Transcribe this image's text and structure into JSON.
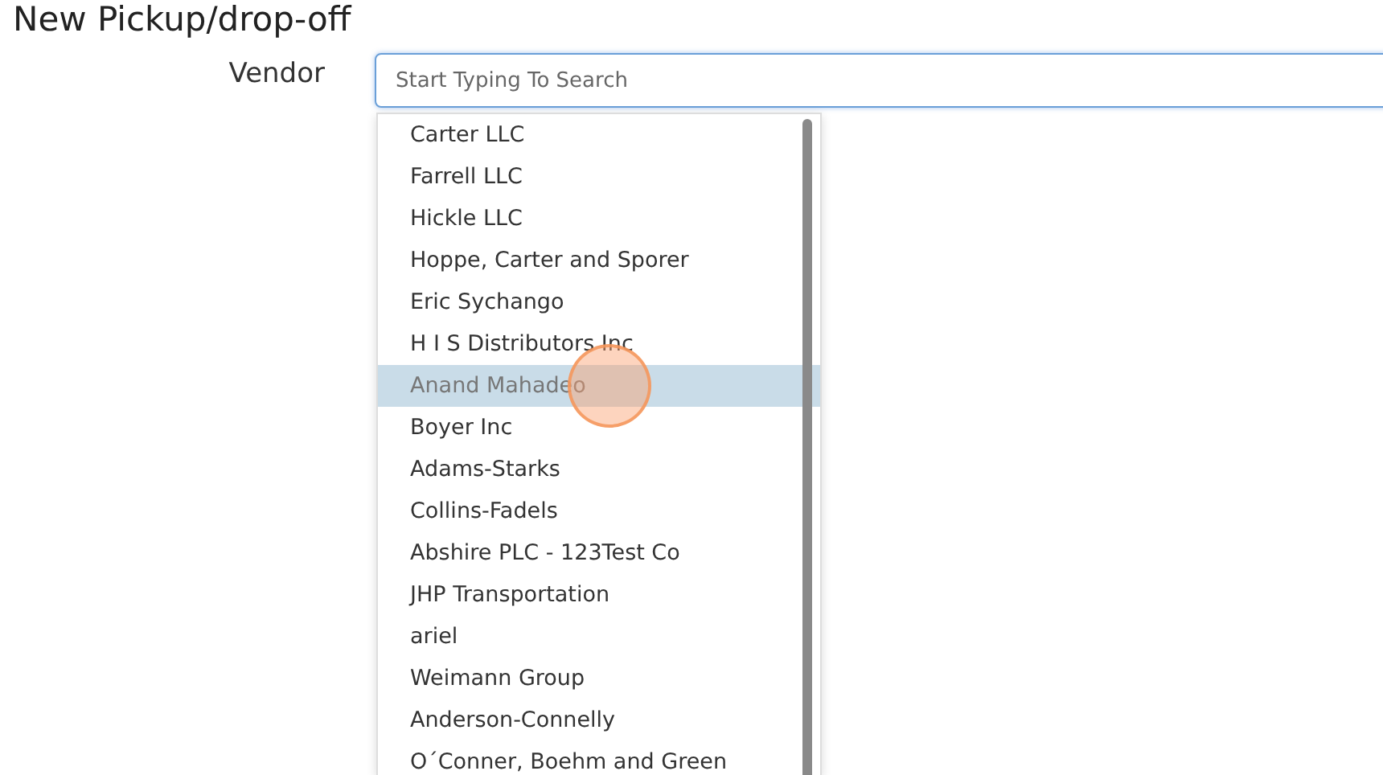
{
  "page": {
    "title": "New Pickup/drop-off"
  },
  "vendor_field": {
    "label": "Vendor",
    "placeholder": "Start Typing To Search"
  },
  "vendor_options": [
    {
      "label": "Carter LLC",
      "selected": false
    },
    {
      "label": "Farrell LLC",
      "selected": false
    },
    {
      "label": "Hickle LLC",
      "selected": false
    },
    {
      "label": "Hoppe, Carter and Sporer",
      "selected": false
    },
    {
      "label": "Eric Sychango",
      "selected": false
    },
    {
      "label": "H I S Distributors Inc",
      "selected": false
    },
    {
      "label": "Anand Mahadeo",
      "selected": true
    },
    {
      "label": "Boyer Inc",
      "selected": false
    },
    {
      "label": "Adams-Starks",
      "selected": false
    },
    {
      "label": "Collins-Fadels",
      "selected": false
    },
    {
      "label": "Abshire PLC - 123Test Co",
      "selected": false
    },
    {
      "label": "JHP Transportation",
      "selected": false
    },
    {
      "label": "ariel",
      "selected": false
    },
    {
      "label": "Weimann Group",
      "selected": false
    },
    {
      "label": "Anderson-Connelly",
      "selected": false
    },
    {
      "label": "O´Conner, Boehm and Green",
      "selected": false
    }
  ]
}
